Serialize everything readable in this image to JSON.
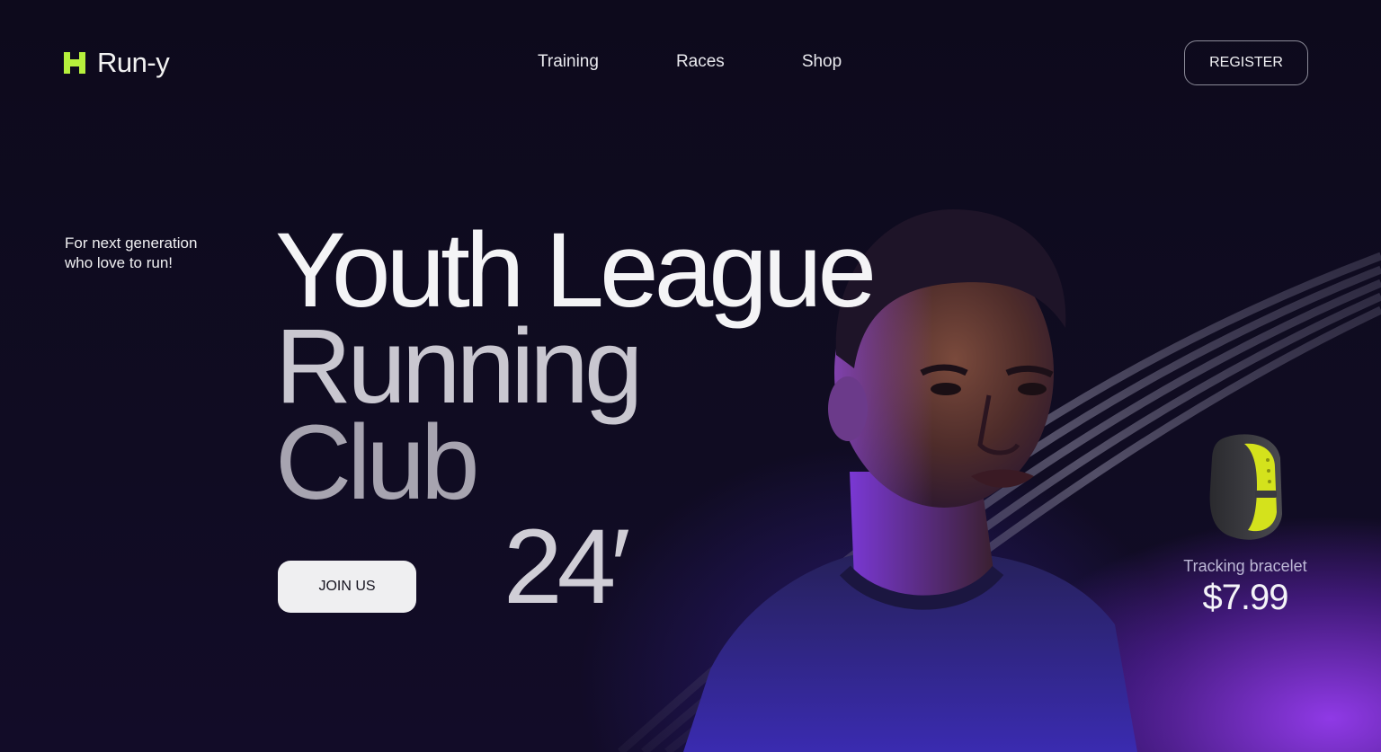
{
  "brand": {
    "name": "Run-y",
    "accent_color": "#b6f03c",
    "icon": "logo-h-icon"
  },
  "nav": {
    "items": [
      {
        "label": "Training"
      },
      {
        "label": "Races"
      },
      {
        "label": "Shop"
      }
    ]
  },
  "header": {
    "register_label": "REGISTER"
  },
  "hero": {
    "tagline": "For next generation who love to run!",
    "headline_lines": [
      "Youth League",
      "Running",
      "Club"
    ],
    "year": "24′",
    "join_label": "JOIN US",
    "image": "runner-portrait"
  },
  "product": {
    "image": "tracking-bracelet-icon",
    "name": "Tracking bracelet",
    "price": "$7.99",
    "accent_color": "#d4e21c"
  },
  "colors": {
    "background": "#0d0a1c",
    "glow": "#9a3cf0"
  }
}
